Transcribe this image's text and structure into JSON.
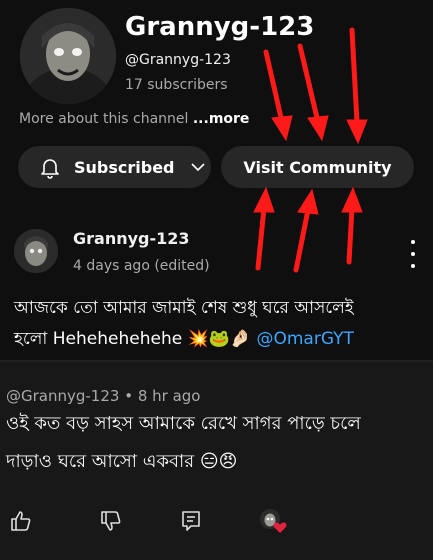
{
  "channel": {
    "name": "Grannyg-123",
    "handle": "@Grannyg-123",
    "subscribers": "17 subscribers",
    "about_text": "More about this channel ",
    "about_more": "...more"
  },
  "buttons": {
    "subscribed_label": "Subscribed",
    "visit_community_label": "Visit Community"
  },
  "post": {
    "author": "Grannyg-123",
    "time": "4 days ago (edited)",
    "text_line1": "আজকে তো আমার জামাই শেষ শুধু ঘরে আসলেই",
    "text_line2": "হলো Hehehehehehe 💥🐸🤌🏻",
    "mention": "@OmarGYT"
  },
  "shared_comment": {
    "meta": "@Grannyg-123 • 8 hr ago",
    "line1": "ওই কত বড় সাহস আমাকে রেখে সাগর পাড়ে চলে",
    "line2": "দাড়াও ঘরে আসো একবার 😑😠"
  },
  "colors": {
    "background": "#0f0f0f",
    "button_bg": "#272727",
    "mention": "#3ea6ff",
    "annotation_arrow": "#ff1a1a",
    "reaction_heart": "#e02440"
  },
  "icons": [
    "bell-icon",
    "chevron-down-icon",
    "kebab-menu-icon",
    "thumbs-up-icon",
    "thumbs-down-icon",
    "comments-icon",
    "creator-heart-icon"
  ]
}
